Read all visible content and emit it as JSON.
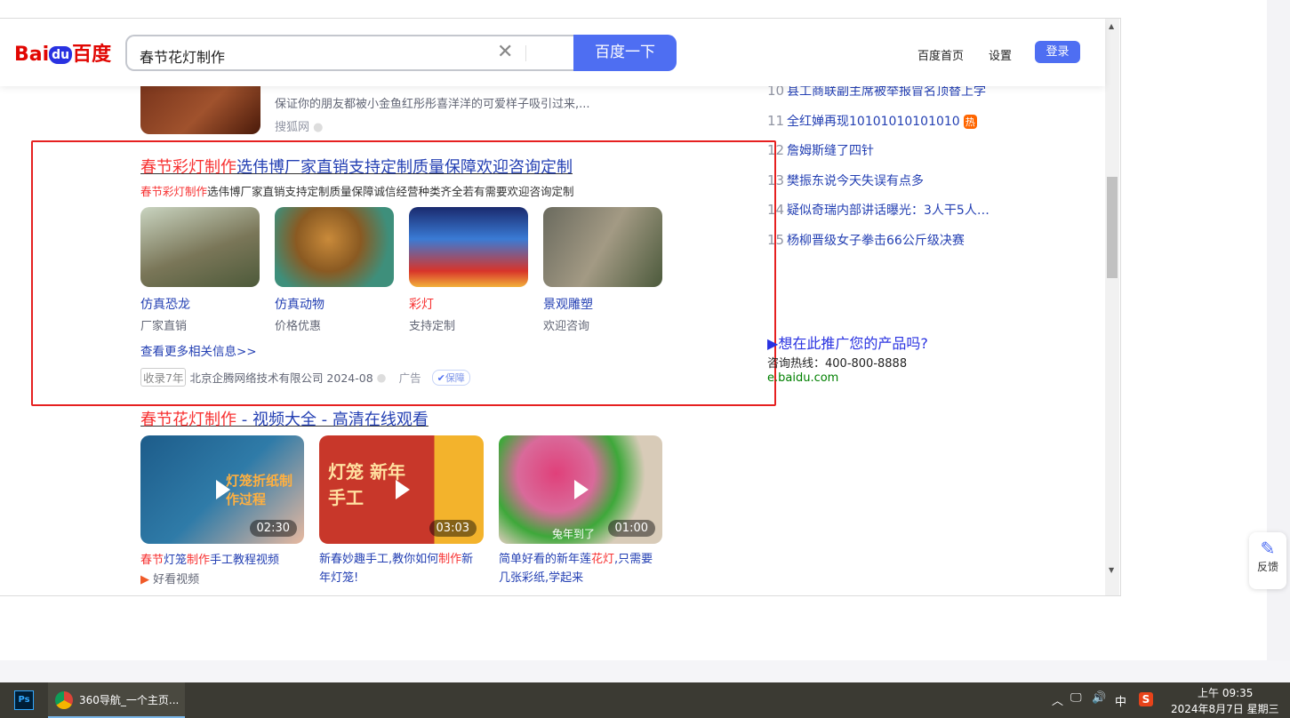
{
  "header": {
    "logo": "Bai百度",
    "logo_du": "du",
    "query": "春节花灯制作",
    "search_button": "百度一下",
    "links": [
      "百度首页",
      "设置"
    ],
    "login": "登录"
  },
  "top_result": {
    "snippet": "保证你的朋友都被小金鱼红彤彤喜洋洋的可爱样子吸引过来,...",
    "source": "搜狐网"
  },
  "ad": {
    "title_red": "春节彩灯制作",
    "title_blue": "选伟博厂家直销支持定制质量保障欢迎咨询定制",
    "desc_red": "春节彩灯制作",
    "desc": "选伟博厂家直销支持定制质量保障诚信经营种类齐全若有需要欢迎咨询定制",
    "items": [
      {
        "name": "仿真恐龙",
        "sub": "厂家直销"
      },
      {
        "name": "仿真动物",
        "sub": "价格优惠"
      },
      {
        "name": "彩灯",
        "sub": "支持定制"
      },
      {
        "name": "景观雕塑",
        "sub": "欢迎咨询"
      }
    ],
    "more": "查看更多相关信息>>",
    "years": "收录7年",
    "company": "北京企腾网络技术有限公司 2024-08",
    "ad_label": "广告",
    "badge": "保障"
  },
  "video": {
    "title_red": "春节花灯制作",
    "title_blue": " - 视频大全 - 高清在线观看",
    "items": [
      {
        "duration": "02:30",
        "t1": "春节",
        "t2": "灯笼",
        "t3": "制作",
        "t4": "手工教程视频",
        "source": "好看视频",
        "overlay": "灯笼折纸制作过程"
      },
      {
        "duration": "03:03",
        "t1": "新春妙趣手工,教你如何",
        "t2": "制作",
        "t3": "新年灯笼!",
        "overlay": "灯笼 新年手工"
      },
      {
        "duration": "01:00",
        "t1": "简单好看的新年莲",
        "t2": "花灯",
        "t3": ",只需要几张彩纸,学起来",
        "overlay": "兔年到了"
      }
    ]
  },
  "hot_list": [
    {
      "rank": "10",
      "text": "县工商联副主席被举报冒名顶替上学"
    },
    {
      "rank": "11",
      "text": "全红婵再现10101010101010",
      "hot": "热"
    },
    {
      "rank": "12",
      "text": "詹姆斯缝了四针"
    },
    {
      "rank": "13",
      "text": "樊振东说今天失误有点多"
    },
    {
      "rank": "14",
      "text": "疑似奇瑞内部讲话曝光：3人干5人…"
    },
    {
      "rank": "15",
      "text": "杨柳晋级女子拳击66公斤级决赛"
    }
  ],
  "promo": {
    "title": "想在此推广您的产品吗?",
    "hotline": "咨询热线：400-800-8888",
    "url": "e.baidu.com"
  },
  "feedback": "反馈",
  "taskbar": {
    "app": "360导航_一个主页...",
    "ime": "中",
    "time": "上午 09:35",
    "date": "2024年8月7日 星期三"
  },
  "colors": {
    "accent": "#4e6ef2",
    "highlight_box": "#e62020"
  }
}
